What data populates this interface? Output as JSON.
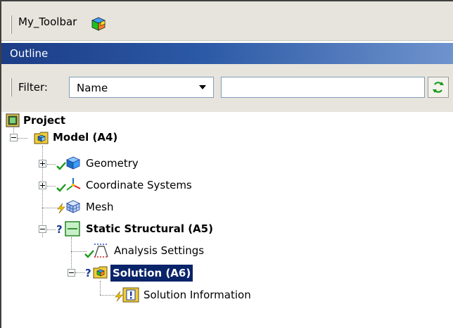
{
  "toolbar": {
    "title": "My_Toolbar",
    "icon": "colored-cube-icon"
  },
  "outline": {
    "title": "Outline"
  },
  "filter": {
    "label": "Filter:",
    "selected": "Name",
    "text": "",
    "refresh_icon": "refresh-icon"
  },
  "tree": {
    "project": "Project",
    "model": "Model (A4)",
    "geometry": "Geometry",
    "coordinate_systems": "Coordinate Systems",
    "mesh": "Mesh",
    "static_structural": "Static Structural (A5)",
    "analysis_settings": "Analysis Settings",
    "solution": "Solution (A6)",
    "solution_information": "Solution Information"
  },
  "colors": {
    "header_gradient_start": "#1c3c86",
    "header_gradient_end": "#6f93cd",
    "selection": "#0a246a",
    "check_green": "#1a9a1a",
    "lightning_yellow": "#f2c200",
    "question_blue": "#1a3c9a"
  }
}
